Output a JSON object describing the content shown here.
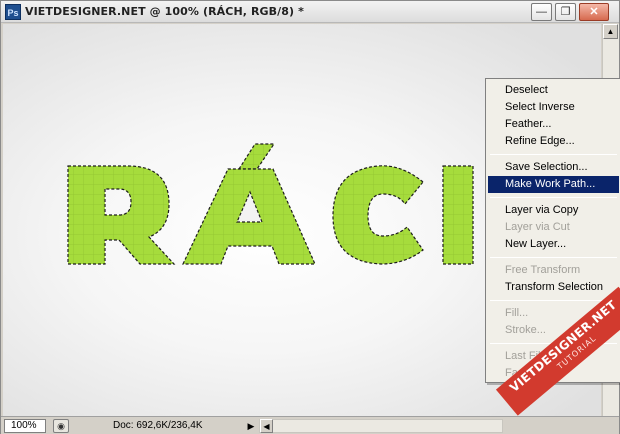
{
  "window": {
    "title": "VIETDESIGNER.NET @ 100% (RÁCH, RGB/8) *",
    "app_icon_label": "Ps",
    "controls": [
      "minimize-icon",
      "restore-icon",
      "close-icon"
    ]
  },
  "canvas": {
    "text_layer": "RÁCH",
    "fill_color": "#a6dc3c",
    "selection": "marching-ants"
  },
  "statusbar": {
    "zoom": "100%",
    "doc_info": "Doc: 692,6K/236,4K"
  },
  "context_menu": {
    "highlight_color": "#0a246a",
    "groups": [
      [
        {
          "label": "Deselect",
          "enabled": true
        },
        {
          "label": "Select Inverse",
          "enabled": true
        },
        {
          "label": "Feather...",
          "enabled": true
        },
        {
          "label": "Refine Edge...",
          "enabled": true
        }
      ],
      [
        {
          "label": "Save Selection...",
          "enabled": true
        },
        {
          "label": "Make Work Path...",
          "enabled": true,
          "highlighted": true
        }
      ],
      [
        {
          "label": "Layer via Copy",
          "enabled": true
        },
        {
          "label": "Layer via Cut",
          "enabled": false
        },
        {
          "label": "New Layer...",
          "enabled": true
        }
      ],
      [
        {
          "label": "Free Transform",
          "enabled": false
        },
        {
          "label": "Transform Selection",
          "enabled": true
        }
      ],
      [
        {
          "label": "Fill...",
          "enabled": false
        },
        {
          "label": "Stroke...",
          "enabled": false
        }
      ],
      [
        {
          "label": "Last Filter",
          "enabled": false
        },
        {
          "label": "Fade...",
          "enabled": false
        }
      ]
    ]
  },
  "watermark": {
    "site": "VIETDESIGNER.NET",
    "tag": "TUTORIAL",
    "color": "#d23a2e"
  }
}
